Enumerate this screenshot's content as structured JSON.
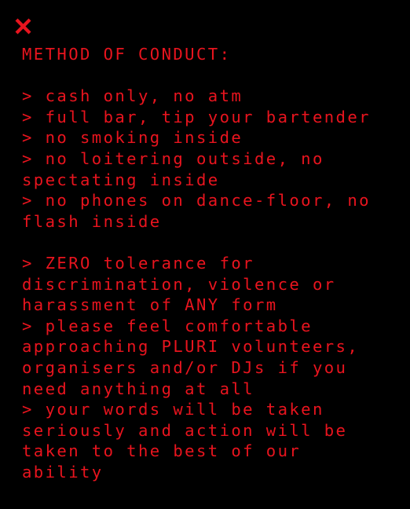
{
  "close": {
    "label": "X",
    "icon": "close-icon"
  },
  "colors": {
    "text": "#e8141e",
    "background": "#000000"
  },
  "title": "METHOD OF CONDUCT:",
  "rules_group_1": [
    "> cash only, no atm",
    "> full bar, tip your bartender",
    "> no smoking inside",
    "> no loitering outside, no",
    "spectating inside",
    "> no phones on dance-floor, no",
    "flash inside"
  ],
  "rules_group_2": [
    "> ZERO tolerance for",
    "discrimination, violence or",
    "harassment of ANY form",
    "> please feel comfortable",
    "approaching PLURI volunteers,",
    "organisers and/or DJs if you",
    "need anything at all",
    "> your words will be taken",
    "seriously and action will be",
    "taken to the best of our",
    "ability"
  ]
}
